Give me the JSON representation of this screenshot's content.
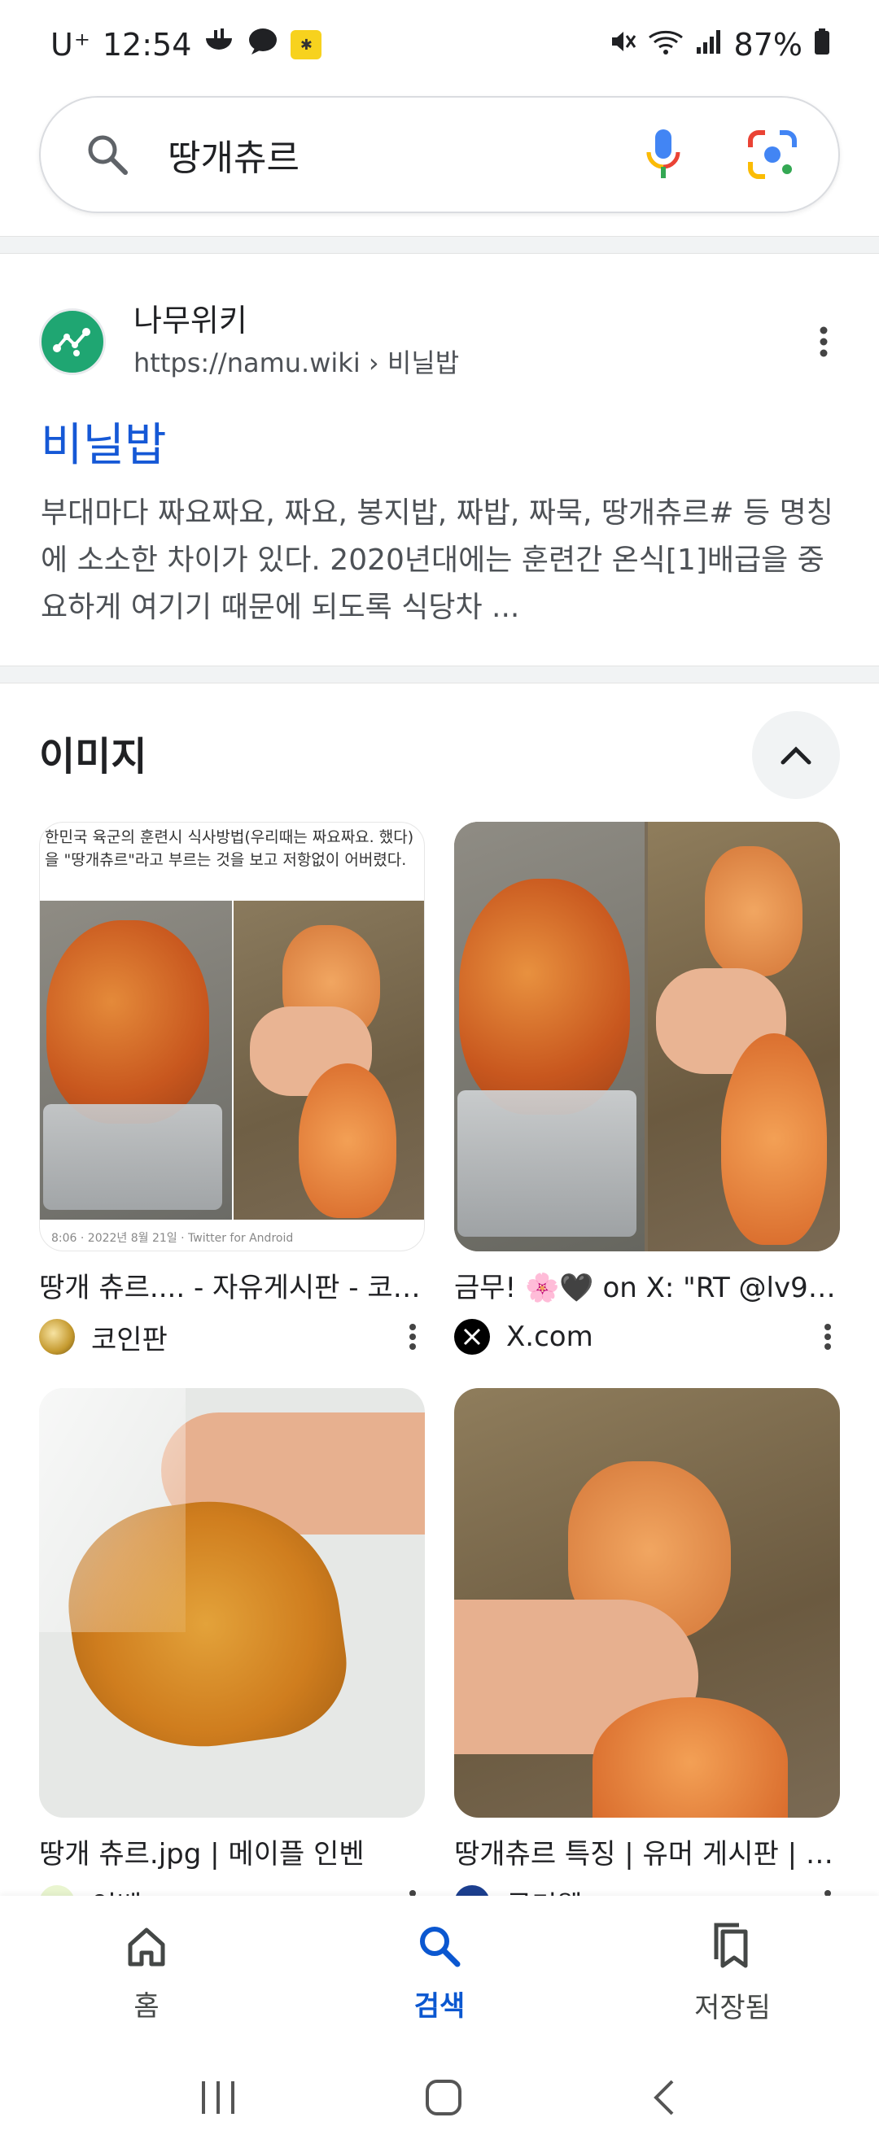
{
  "status_bar": {
    "carrier": "U⁺",
    "time": "12:54",
    "battery": "87%"
  },
  "search": {
    "query": "땅개츄르"
  },
  "result": {
    "site_name": "나무위키",
    "url": "https://namu.wiki",
    "breadcrumb": "› 비닐밥",
    "title": "비닐밥",
    "snippet": "부대마다 짜요짜요, 짜요, 봉지밥, 짜밥, 짜묵, 땅개츄르# 등 명칭에 소소한 차이가 있다. 2020년대에는 훈련간 온식[1]배급을 중요하게 여기기 때문에 되도록 식당차 ..."
  },
  "images": {
    "title": "이미지",
    "items": [
      {
        "caption": "땅개 츄르.... - 자유게시판 - 코인판",
        "source": "코인판",
        "overlay_text": "한민국 육군의 훈련시 식사방법(우리때는 짜요짜요. 했다)을 \"땅개츄르\"라고 부르는 것을 보고 저항없이 어버렸다.",
        "footer_text": "8:06 · 2022년 8월 21일 · Twitter for Android"
      },
      {
        "caption": "금무! 🌸🖤 on X: \"RT @lv99...",
        "source": "X.com"
      },
      {
        "caption": "땅개 츄르.jpg | 메이플 인벤",
        "source": "인벤"
      },
      {
        "caption": "땅개츄르 특징 | 유머 게시판 | R...",
        "source": "루리웹"
      }
    ]
  },
  "bottom_nav": {
    "home": "홈",
    "search": "검색",
    "saved": "저장됨"
  }
}
